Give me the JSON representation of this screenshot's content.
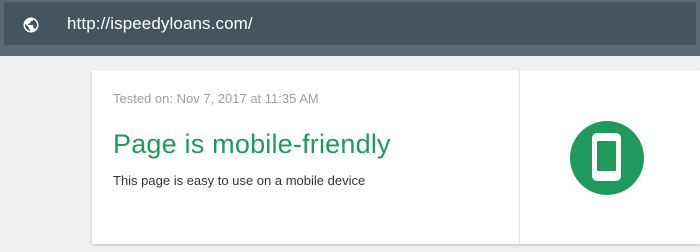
{
  "address_bar": {
    "icon": "globe-icon",
    "url": "http://ispeedyloans.com/"
  },
  "result": {
    "tested_on": "Tested on: Nov 7, 2017 at 11:35 AM",
    "headline": "Page is mobile-friendly",
    "description": "This page is easy to use on a mobile device",
    "status_icon": "mobile-phone-icon"
  },
  "colors": {
    "topbar": "#5c6b73",
    "urlbox": "#46555d",
    "success": "#1e9a5c"
  }
}
